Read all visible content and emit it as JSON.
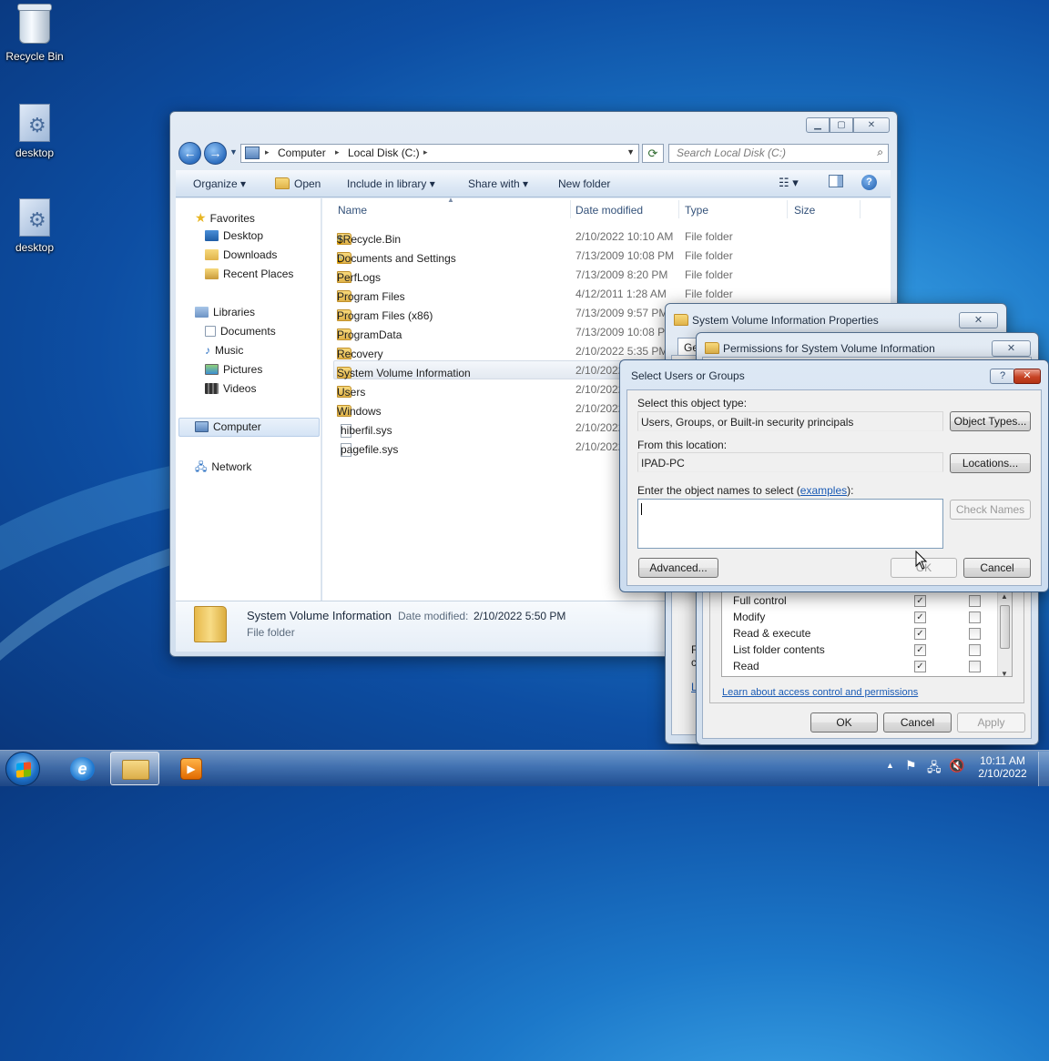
{
  "desktop": {
    "icons": [
      {
        "label": "Recycle Bin"
      },
      {
        "label": "desktop"
      },
      {
        "label": "desktop"
      }
    ]
  },
  "explorer": {
    "breadcrumb": [
      "Computer",
      "Local Disk (C:)"
    ],
    "search_placeholder": "Search Local Disk (C:)",
    "toolbar": {
      "organize": "Organize",
      "open": "Open",
      "include_in_library": "Include in library",
      "share_with": "Share with",
      "new_folder": "New folder"
    },
    "nav": {
      "favorites": "Favorites",
      "desktop": "Desktop",
      "downloads": "Downloads",
      "recent": "Recent Places",
      "libraries": "Libraries",
      "documents": "Documents",
      "music": "Music",
      "pictures": "Pictures",
      "videos": "Videos",
      "computer": "Computer",
      "network": "Network"
    },
    "columns": {
      "name": "Name",
      "date": "Date modified",
      "type": "Type",
      "size": "Size"
    },
    "rows": [
      {
        "name": "$Recycle.Bin",
        "date": "2/10/2022 10:10 AM",
        "type": "File folder"
      },
      {
        "name": "Documents and Settings",
        "date": "7/13/2009 10:08 PM",
        "type": "File folder"
      },
      {
        "name": "PerfLogs",
        "date": "7/13/2009 8:20 PM",
        "type": "File folder"
      },
      {
        "name": "Program Files",
        "date": "4/12/2011 1:28 AM",
        "type": "File folder"
      },
      {
        "name": "Program Files (x86)",
        "date": "7/13/2009 9:57 PM",
        "type": ""
      },
      {
        "name": "ProgramData",
        "date": "7/13/2009 10:08 PM",
        "type": ""
      },
      {
        "name": "Recovery",
        "date": "2/10/2022 5:35 PM",
        "type": ""
      },
      {
        "name": "System Volume Information",
        "date": "2/10/2022",
        "type": ""
      },
      {
        "name": "Users",
        "date": "2/10/2022",
        "type": ""
      },
      {
        "name": "Windows",
        "date": "2/10/2022",
        "type": ""
      },
      {
        "name": "hiberfil.sys",
        "date": "2/10/2022",
        "type": ""
      },
      {
        "name": "pagefile.sys",
        "date": "2/10/2022",
        "type": ""
      }
    ],
    "details": {
      "name": "System Volume Information",
      "date_label": "Date modified:",
      "date_value": "2/10/2022 5:50 PM",
      "type": "File folder"
    }
  },
  "properties": {
    "title": "System Volume Information Properties",
    "tab_fragment": "Ge",
    "side_fragments": [
      "F",
      "c",
      "L"
    ],
    "ok": "OK",
    "cancel": "Cancel",
    "apply": "Apply"
  },
  "permissions": {
    "title": "Permissions for System Volume Information",
    "entries": [
      {
        "label": "Full control",
        "allow": true,
        "deny": false
      },
      {
        "label": "Modify",
        "allow": true,
        "deny": false
      },
      {
        "label": "Read & execute",
        "allow": true,
        "deny": false
      },
      {
        "label": "List folder contents",
        "allow": true,
        "deny": false
      },
      {
        "label": "Read",
        "allow": true,
        "deny": false
      }
    ],
    "learn_link": "Learn about access control and permissions"
  },
  "select_dialog": {
    "title": "Select Users or Groups",
    "object_type_label": "Select this object type:",
    "object_type_value": "Users, Groups, or Built-in security principals",
    "object_types_btn": "Object Types...",
    "location_label": "From this location:",
    "location_value": "IPAD-PC",
    "locations_btn": "Locations...",
    "enter_label_pre": "Enter the object names to select (",
    "enter_label_link": "examples",
    "enter_label_post": "):",
    "check_names_btn": "Check Names",
    "advanced_btn": "Advanced...",
    "ok_btn": "OK",
    "cancel_btn": "Cancel"
  },
  "taskbar": {
    "time": "10:11 AM",
    "date": "2/10/2022"
  }
}
